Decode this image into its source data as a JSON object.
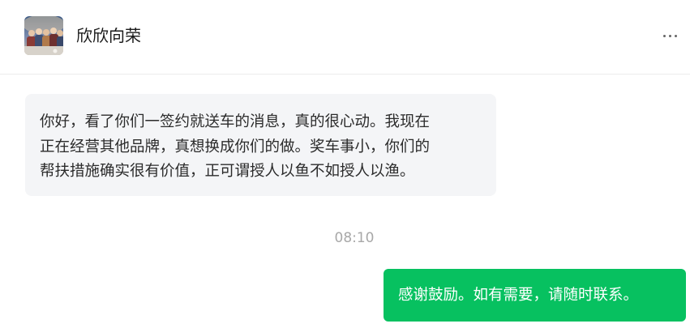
{
  "header": {
    "contact_name": "欣欣向荣",
    "avatar_icon": "group-photo-avatar",
    "more_icon": "more-dots-icon"
  },
  "messages": {
    "incoming": {
      "lines": [
        "你好，看了你们一签约就送车的消息，真的很心动。我现在",
        "正在经营其他品牌，真想换成你们的做。奖车事小，你们的",
        "帮扶措施确实很有价值，正可谓授人以鱼不如授人以渔。"
      ]
    },
    "timestamp": "08:10",
    "outgoing": {
      "text": "感谢鼓励。如有需要，请随时联系。"
    }
  },
  "colors": {
    "outgoing_bubble": "#07c160",
    "incoming_bubble": "#f4f5f7",
    "timestamp": "#a8a8a8"
  }
}
